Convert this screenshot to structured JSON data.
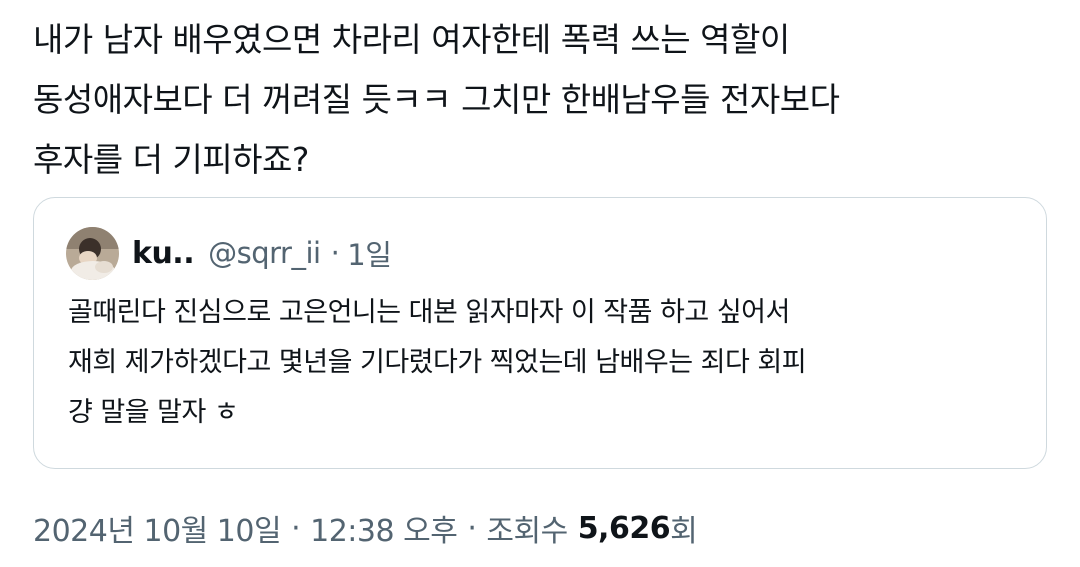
{
  "tweet": {
    "text_lines": [
      "내가 남자 배우였으면 차라리 여자한테 폭력 쓰는 역할이",
      "동성애자보다 더 꺼려질 듯ㅋㅋ 그치만 한배남우들 전자보다",
      "후자를 더 기피하죠?"
    ]
  },
  "quote": {
    "avatar": "avatar-photo",
    "name": "ku..",
    "handle": "@sqrr_ii",
    "dot": "·",
    "time": "1일",
    "text_lines": [
      "골때린다 진심으로 고은언니는 대본 읽자마자 이 작품 하고 싶어서",
      "재희 제가하겠다고 몇년을 기다렸다가 찍었는데 남배우는 죄다 회피",
      "걍 말을 말자 ㅎ"
    ]
  },
  "meta": {
    "date": "2024년 10월 10일",
    "sep1": "·",
    "time": "12:38 오후",
    "sep2": "·",
    "views_label": "조회수",
    "views_count": "5,626",
    "views_suffix": "회"
  },
  "colors": {
    "text": "#0f1419",
    "secondary": "#536471",
    "border": "#cfd9de"
  }
}
